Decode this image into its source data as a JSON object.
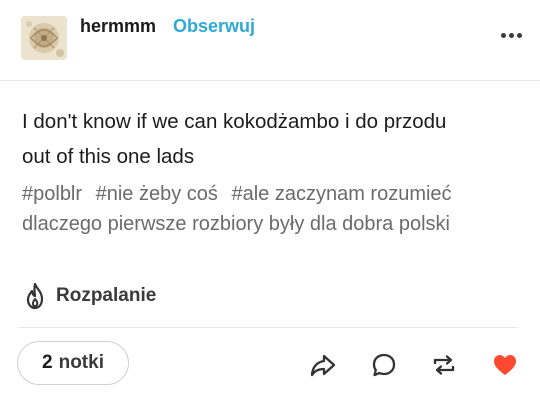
{
  "header": {
    "username": "hermmm",
    "follow_label": "Obserwuj"
  },
  "post": {
    "body_lines": [
      "I don't know if we can kokodżambo i do przodu",
      "out of this one lads"
    ],
    "tags": [
      "#polblr",
      "#nie żeby coś",
      "#ale zaczynam rozumieć dlaczego pierwsze rozbiory były dla dobra polski"
    ],
    "blaze_label": "Rozpalanie"
  },
  "footer": {
    "notes_count": "2",
    "notes_label": "notki"
  },
  "colors": {
    "follow": "#2ea9d6",
    "like": "#ff4930",
    "tag": "#6b6b6b"
  },
  "icons": [
    "avatar",
    "more-dots-icon",
    "flame-icon",
    "share-icon",
    "reply-icon",
    "reblog-icon",
    "heart-icon"
  ]
}
